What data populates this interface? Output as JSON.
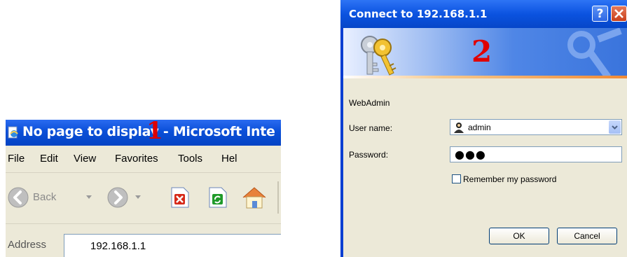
{
  "browser": {
    "title": "No page to display - Microsoft Inte",
    "step_marker": "1",
    "menu": [
      "File",
      "Edit",
      "View",
      "Favorites",
      "Tools",
      "Help"
    ],
    "toolbar": {
      "back_label": "Back"
    },
    "address": {
      "label": "Address",
      "value": "192.168.1.1"
    }
  },
  "dialog": {
    "title": "Connect to 192.168.1.1",
    "help_label": "?",
    "step_marker": "2",
    "realm": "WebAdmin",
    "username_label": "User name:",
    "username_value": "admin",
    "password_label": "Password:",
    "password_value": "●●●",
    "remember_label": "Remember my password",
    "remember_checked": false,
    "ok_label": "OK",
    "cancel_label": "Cancel"
  }
}
